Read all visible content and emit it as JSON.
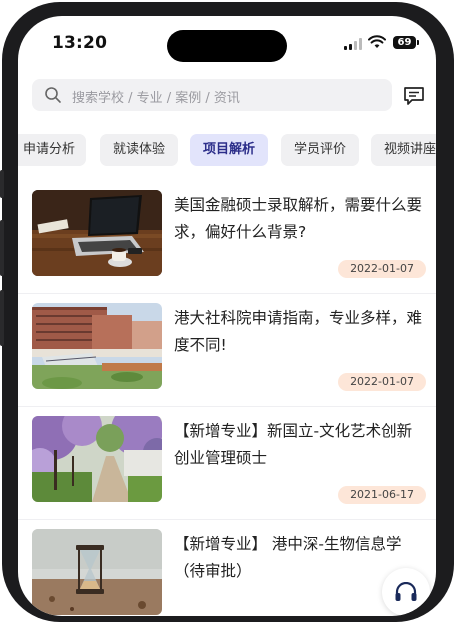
{
  "status_bar": {
    "time": "13:20",
    "battery": "69"
  },
  "search": {
    "placeholder": "搜索学校 / 专业 / 案例 / 资讯"
  },
  "icons": {
    "search": "search-icon",
    "message": "message-icon",
    "support": "headset-icon"
  },
  "tabs": [
    {
      "label": "申请分析",
      "active": false
    },
    {
      "label": "就读体验",
      "active": false
    },
    {
      "label": "项目解析",
      "active": true
    },
    {
      "label": "学员评价",
      "active": false
    },
    {
      "label": "视频讲座",
      "active": false
    }
  ],
  "articles": [
    {
      "title": "美国金融硕士录取解析，需要什么要求，偏好什么背景?",
      "date": "2022-01-07"
    },
    {
      "title": "港大社科院申请指南，专业多样，难度不同!",
      "date": "2022-01-07"
    },
    {
      "title": "【新增专业】新国立-文化艺术创新创业管理硕士",
      "date": "2021-06-17"
    },
    {
      "title": "【新增专业】 港中深-生物信息学（待审批）",
      "date": ""
    }
  ],
  "colors": {
    "accent_tab_bg": "#e2e4fb",
    "accent_tab_text": "#2c2e8a",
    "date_badge_bg": "#fde6d8"
  }
}
